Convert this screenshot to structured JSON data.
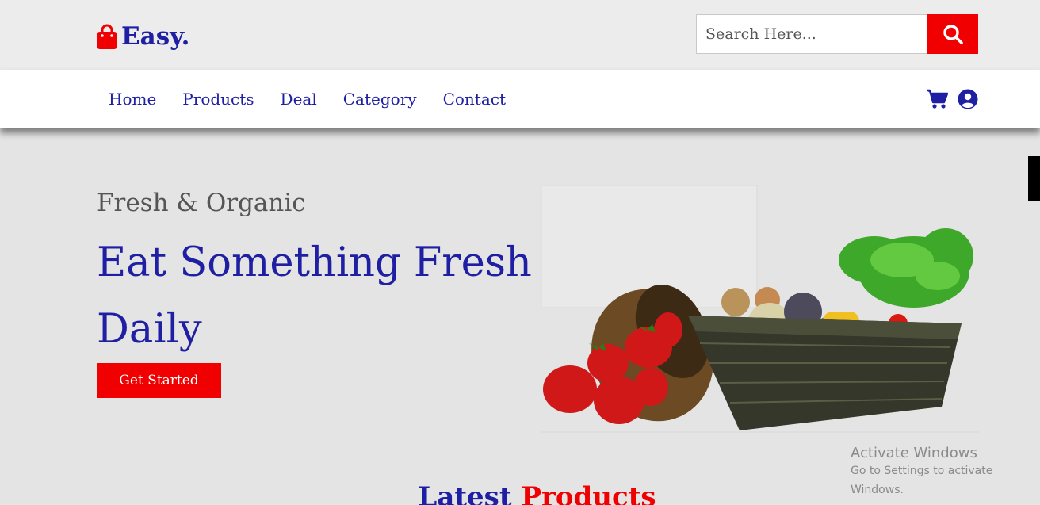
{
  "header": {
    "brand": "Easy.",
    "search": {
      "placeholder": "Search Here...",
      "value": ""
    },
    "search_button_icon": "search-icon"
  },
  "nav": {
    "links": [
      "Home",
      "Products",
      "Deal",
      "Category",
      "Contact"
    ],
    "icons": [
      "cart-icon",
      "user-icon"
    ]
  },
  "hero": {
    "subtitle": "Fresh & Organic",
    "title": "Eat Something Fresh Daily",
    "cta": "Get Started",
    "image": "fruits-vegetables-basket-image"
  },
  "watermark": {
    "title": "Activate Windows",
    "subtitle": "Go to Settings to activate Windows."
  },
  "section": {
    "heading_part1": "Latest",
    "heading_part2": "Products"
  },
  "colors": {
    "primary": "#1f1fa3",
    "accent": "#f00000",
    "background": "#e4e4e4"
  }
}
